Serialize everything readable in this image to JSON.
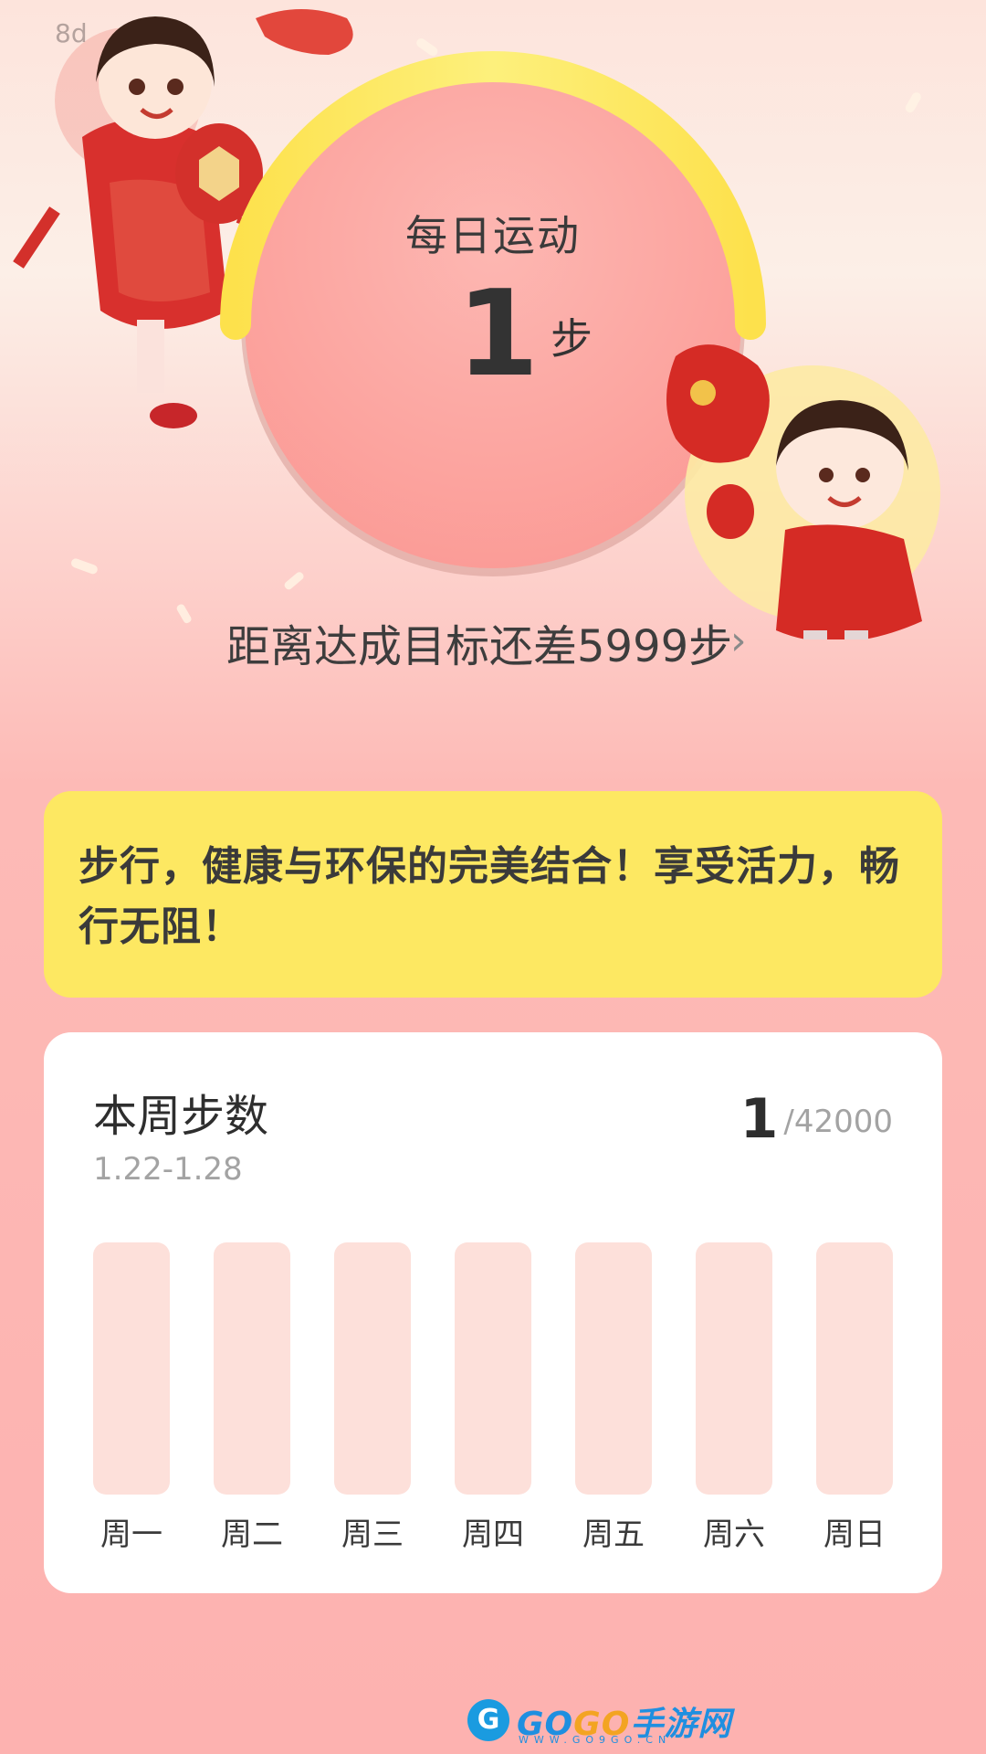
{
  "watermark": "8d",
  "daily": {
    "title": "每日运动",
    "steps": "1",
    "unit": "步",
    "goal_text": "距离达成目标还差5999步",
    "goal_chevron": "›",
    "progress": 0.0002
  },
  "motto": {
    "text": "步行，健康与环保的完美结合！享受活力，畅行无阻！"
  },
  "week": {
    "title": "本周步数",
    "range": "1.22-1.28",
    "total": "1",
    "goal": "/42000",
    "days": [
      {
        "label": "周一",
        "value": 0
      },
      {
        "label": "周二",
        "value": 0
      },
      {
        "label": "周三",
        "value": 0
      },
      {
        "label": "周四",
        "value": 0
      },
      {
        "label": "周五",
        "value": 0
      },
      {
        "label": "周六",
        "value": 0
      },
      {
        "label": "周日",
        "value": 0
      }
    ]
  },
  "colors": {
    "gauge_arc": "#fde254",
    "circle": "#fcb1ad",
    "card_yellow": "#fde862",
    "bar_empty": "#fde0da",
    "bar_fill": "#f8746f"
  },
  "logo": {
    "icon": "G",
    "text_a": "GO",
    "text_b": "GO",
    "text_c": "手游网",
    "sub": "WWW.GO9GO.CN"
  }
}
